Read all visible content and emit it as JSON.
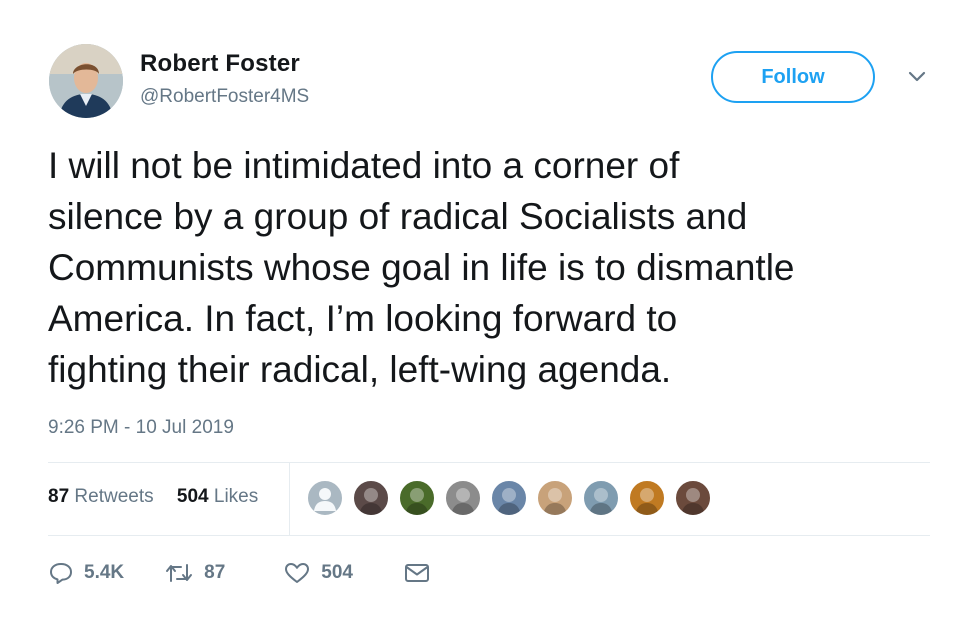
{
  "user": {
    "name": "Robert Foster",
    "handle": "@RobertFoster4MS"
  },
  "follow_label": "Follow",
  "tweet": {
    "text": "I will not be intimidated into a corner of\nsilence by a group of radical Socialists and\nCommunists whose goal in life is to dismantle\nAmerica. In fact, I’m looking forward to\nfighting their radical, left-wing agenda.",
    "timestamp": "9:26 PM - 10 Jul 2019"
  },
  "stats": {
    "retweets_count": "87",
    "retweets_label": "Retweets",
    "likes_count": "504",
    "likes_label": "Likes"
  },
  "likers": [
    {
      "color": "#aab8c2",
      "icon": "default-avatar"
    },
    {
      "color": "#5b4a48"
    },
    {
      "color": "#4a6b2a"
    },
    {
      "color": "#8c8c8c"
    },
    {
      "color": "#6a86a8"
    },
    {
      "color": "#c8a27a"
    },
    {
      "color": "#7f9cb0"
    },
    {
      "color": "#c07a22"
    },
    {
      "color": "#6b4a3c"
    }
  ],
  "actions": {
    "replies": "5.4K",
    "retweets": "87",
    "likes": "504"
  },
  "colors": {
    "accent": "#1da1f2",
    "muted": "#657786",
    "divider": "#e6ecf0"
  }
}
